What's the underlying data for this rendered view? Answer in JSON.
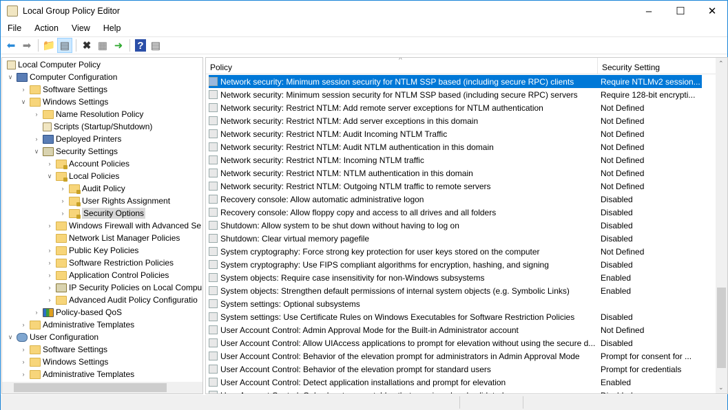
{
  "window": {
    "title": "Local Group Policy Editor"
  },
  "menu": [
    "File",
    "Action",
    "View",
    "Help"
  ],
  "tree": [
    {
      "label": "Local Computer Policy",
      "level": 0,
      "exp": "",
      "icon": "doc"
    },
    {
      "label": "Computer Configuration",
      "level": 0,
      "exp": "v",
      "icon": "pc",
      "indent": 1
    },
    {
      "label": "Software Settings",
      "level": 2,
      "exp": ">",
      "icon": "folder"
    },
    {
      "label": "Windows Settings",
      "level": 2,
      "exp": "v",
      "icon": "folder"
    },
    {
      "label": "Name Resolution Policy",
      "level": 3,
      "exp": ">",
      "icon": "folder"
    },
    {
      "label": "Scripts (Startup/Shutdown)",
      "level": 3,
      "exp": "",
      "icon": "doc"
    },
    {
      "label": "Deployed Printers",
      "level": 3,
      "exp": ">",
      "icon": "pc"
    },
    {
      "label": "Security Settings",
      "level": 3,
      "exp": "v",
      "icon": "shield"
    },
    {
      "label": "Account Policies",
      "level": 4,
      "exp": ">",
      "icon": "lock"
    },
    {
      "label": "Local Policies",
      "level": 4,
      "exp": "v",
      "icon": "lock"
    },
    {
      "label": "Audit Policy",
      "level": 5,
      "exp": ">",
      "icon": "lock"
    },
    {
      "label": "User Rights Assignment",
      "level": 5,
      "exp": ">",
      "icon": "lock"
    },
    {
      "label": "Security Options",
      "level": 5,
      "exp": ">",
      "icon": "lock",
      "selected": true
    },
    {
      "label": "Windows Firewall with Advanced Se",
      "level": 4,
      "exp": ">",
      "icon": "folder"
    },
    {
      "label": "Network List Manager Policies",
      "level": 4,
      "exp": "",
      "icon": "folder"
    },
    {
      "label": "Public Key Policies",
      "level": 4,
      "exp": ">",
      "icon": "folder"
    },
    {
      "label": "Software Restriction Policies",
      "level": 4,
      "exp": ">",
      "icon": "folder"
    },
    {
      "label": "Application Control Policies",
      "level": 4,
      "exp": ">",
      "icon": "folder"
    },
    {
      "label": "IP Security Policies on Local Compu",
      "level": 4,
      "exp": ">",
      "icon": "shield"
    },
    {
      "label": "Advanced Audit Policy Configuratio",
      "level": 4,
      "exp": ">",
      "icon": "folder"
    },
    {
      "label": "Policy-based QoS",
      "level": 3,
      "exp": ">",
      "icon": "chart"
    },
    {
      "label": "Administrative Templates",
      "level": 2,
      "exp": ">",
      "icon": "folder"
    },
    {
      "label": "User Configuration",
      "level": 0,
      "exp": "v",
      "icon": "user",
      "indent": 1
    },
    {
      "label": "Software Settings",
      "level": 2,
      "exp": ">",
      "icon": "folder"
    },
    {
      "label": "Windows Settings",
      "level": 2,
      "exp": ">",
      "icon": "folder"
    },
    {
      "label": "Administrative Templates",
      "level": 2,
      "exp": ">",
      "icon": "folder"
    }
  ],
  "columns": {
    "policy": "Policy",
    "setting": "Security Setting"
  },
  "policies": [
    {
      "name": "Network security: Minimum session security for NTLM SSP based (including secure RPC) clients",
      "setting": "Require NTLMv2 session...",
      "selected": true
    },
    {
      "name": "Network security: Minimum session security for NTLM SSP based (including secure RPC) servers",
      "setting": "Require 128-bit encrypti..."
    },
    {
      "name": "Network security: Restrict NTLM: Add remote server exceptions for NTLM authentication",
      "setting": "Not Defined"
    },
    {
      "name": "Network security: Restrict NTLM: Add server exceptions in this domain",
      "setting": "Not Defined"
    },
    {
      "name": "Network security: Restrict NTLM: Audit Incoming NTLM Traffic",
      "setting": "Not Defined"
    },
    {
      "name": "Network security: Restrict NTLM: Audit NTLM authentication in this domain",
      "setting": "Not Defined"
    },
    {
      "name": "Network security: Restrict NTLM: Incoming NTLM traffic",
      "setting": "Not Defined"
    },
    {
      "name": "Network security: Restrict NTLM: NTLM authentication in this domain",
      "setting": "Not Defined"
    },
    {
      "name": "Network security: Restrict NTLM: Outgoing NTLM traffic to remote servers",
      "setting": "Not Defined"
    },
    {
      "name": "Recovery console: Allow automatic administrative logon",
      "setting": "Disabled"
    },
    {
      "name": "Recovery console: Allow floppy copy and access to all drives and all folders",
      "setting": "Disabled"
    },
    {
      "name": "Shutdown: Allow system to be shut down without having to log on",
      "setting": "Disabled"
    },
    {
      "name": "Shutdown: Clear virtual memory pagefile",
      "setting": "Disabled"
    },
    {
      "name": "System cryptography: Force strong key protection for user keys stored on the computer",
      "setting": "Not Defined"
    },
    {
      "name": "System cryptography: Use FIPS compliant algorithms for encryption, hashing, and signing",
      "setting": "Disabled"
    },
    {
      "name": "System objects: Require case insensitivity for non-Windows subsystems",
      "setting": "Enabled"
    },
    {
      "name": "System objects: Strengthen default permissions of internal system objects (e.g. Symbolic Links)",
      "setting": "Enabled"
    },
    {
      "name": "System settings: Optional subsystems",
      "setting": ""
    },
    {
      "name": "System settings: Use Certificate Rules on Windows Executables for Software Restriction Policies",
      "setting": "Disabled"
    },
    {
      "name": "User Account Control: Admin Approval Mode for the Built-in Administrator account",
      "setting": "Not Defined"
    },
    {
      "name": "User Account Control: Allow UIAccess applications to prompt for elevation without using the secure d...",
      "setting": "Disabled"
    },
    {
      "name": "User Account Control: Behavior of the elevation prompt for administrators in Admin Approval Mode",
      "setting": "Prompt for consent for ..."
    },
    {
      "name": "User Account Control: Behavior of the elevation prompt for standard users",
      "setting": "Prompt for credentials"
    },
    {
      "name": "User Account Control: Detect application installations and prompt for elevation",
      "setting": "Enabled"
    },
    {
      "name": "User Account Control: Only elevate executables that are signed and validated",
      "setting": "Disabled"
    }
  ]
}
